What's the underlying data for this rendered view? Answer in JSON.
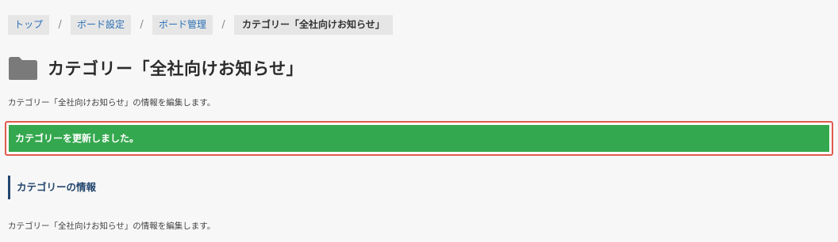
{
  "breadcrumb": {
    "items": [
      "トップ",
      "ボード設定",
      "ボード管理"
    ],
    "current": "カテゴリー「全社向けお知らせ」",
    "separator": "/"
  },
  "header": {
    "icon": "folder-icon",
    "title": "カテゴリー「全社向けお知らせ」",
    "description": "カテゴリー「全社向けお知らせ」の情報を編集します。"
  },
  "alert": {
    "message": "カテゴリーを更新しました。",
    "color": "#34a84e",
    "border_color": "#e05a4f"
  },
  "section": {
    "heading": "カテゴリーの情報",
    "description": "カテゴリー「全社向けお知らせ」の情報を編集します。"
  }
}
